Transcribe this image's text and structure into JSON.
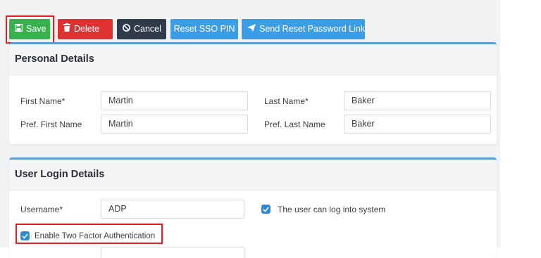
{
  "toolbar": {
    "save_label": "Save",
    "delete_label": "Delete",
    "cancel_label": "Cancel",
    "reset_sso_label": "Reset SSO PIN",
    "send_reset_label": "Send Reset Password Link"
  },
  "personal": {
    "title": "Personal Details",
    "first_name_label": "First Name*",
    "first_name_value": "Martin",
    "last_name_label": "Last Name*",
    "last_name_value": "Baker",
    "pref_first_label": "Pref. First Name",
    "pref_first_value": "Martin",
    "pref_last_label": "Pref. Last Name",
    "pref_last_value": "Baker"
  },
  "login": {
    "title": "User Login Details",
    "username_label": "Username*",
    "username_value": "ADP",
    "can_login_label": "The user can log into system",
    "two_factor_label": "Enable Two Factor Authentication"
  },
  "colors": {
    "save": "#37b24d",
    "delete": "#e03131",
    "cancel": "#2f3b4a",
    "primary": "#3a9ee6",
    "highlight": "#e02020"
  }
}
